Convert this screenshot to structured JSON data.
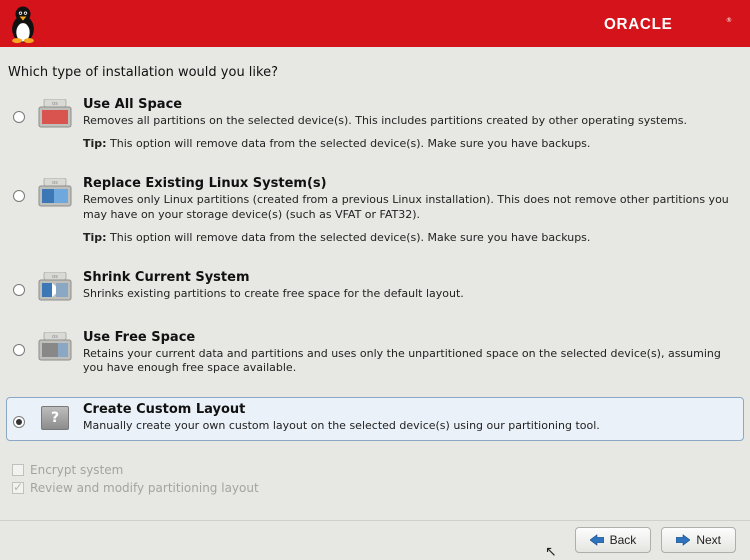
{
  "brand": "ORACLE",
  "question": "Which type of installation would you like?",
  "options": [
    {
      "title": "Use All Space",
      "desc": "Removes all partitions on the selected device(s).  This includes partitions created by other operating systems.",
      "tip": "This option will remove data from the selected device(s).  Make sure you have backups.",
      "selected": false
    },
    {
      "title": "Replace Existing Linux System(s)",
      "desc": "Removes only Linux partitions (created from a previous Linux installation).  This does not remove other partitions you may have on your storage device(s) (such as VFAT or FAT32).",
      "tip": "This option will remove data from the selected device(s).  Make sure you have backups.",
      "selected": false
    },
    {
      "title": "Shrink Current System",
      "desc": "Shrinks existing partitions to create free space for the default layout.",
      "tip": "",
      "selected": false
    },
    {
      "title": "Use Free Space",
      "desc": "Retains your current data and partitions and uses only the unpartitioned space on the selected device(s), assuming you have enough free space available.",
      "tip": "",
      "selected": false
    },
    {
      "title": "Create Custom Layout",
      "desc": "Manually create your own custom layout on the selected device(s) using our partitioning tool.",
      "tip": "",
      "selected": true
    }
  ],
  "checks": {
    "encrypt": {
      "label": "Encrypt system",
      "checked": false
    },
    "review": {
      "label": "Review and modify partitioning layout",
      "checked": true
    }
  },
  "buttons": {
    "back": "Back",
    "next": "Next"
  },
  "tip_prefix": "Tip:"
}
